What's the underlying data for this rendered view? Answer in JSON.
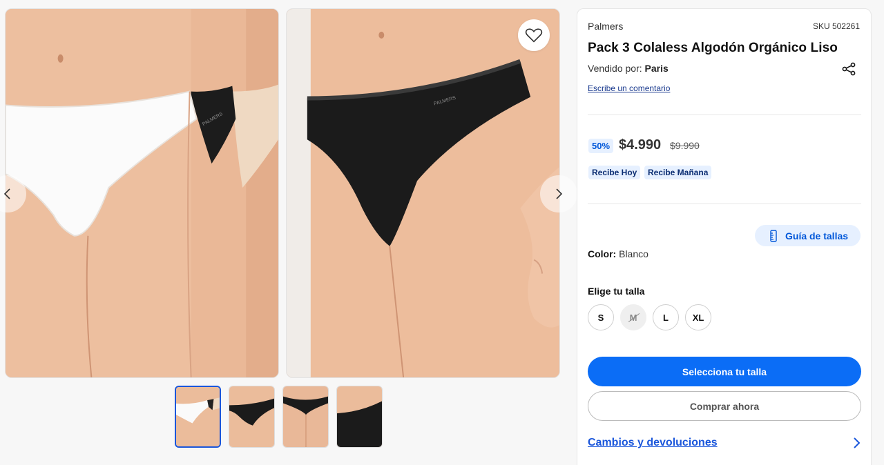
{
  "gallery": {
    "thumbnails": [
      "thumb-white-front",
      "thumb-black-front",
      "thumb-black-back",
      "thumb-black-detail"
    ],
    "active_thumbnail": 0,
    "icons": {
      "prev": "chevron-left-icon",
      "next": "chevron-right-icon",
      "favorite": "heart-icon"
    },
    "print_brand": "PALMERS"
  },
  "product": {
    "brand": "Palmers",
    "sku": "SKU 502261",
    "title": "Pack 3 Colaless Algodón Orgánico Liso",
    "seller_prefix": "Vendido por:",
    "seller_name": "Paris",
    "comment_link": "Escribe un comentario",
    "discount": "50%",
    "price": "$4.990",
    "old_price": "$9.990",
    "delivery_badges": [
      "Recibe Hoy",
      "Recibe Mañana"
    ],
    "size_guide_label": "Guía de tallas",
    "color_label": "Color:",
    "color_value": "Blanco",
    "choose_size_label": "Elige tu talla",
    "sizes": [
      {
        "label": "S",
        "available": true
      },
      {
        "label": "M",
        "available": false
      },
      {
        "label": "L",
        "available": true
      },
      {
        "label": "XL",
        "available": true
      }
    ],
    "primary_button": "Selecciona tu talla",
    "secondary_button": "Comprar ahora",
    "returns_link": "Cambios y devoluciones"
  },
  "colors": {
    "accent": "#0b6df6",
    "link": "#1a56db",
    "badge_bg": "#e6f0ff"
  }
}
